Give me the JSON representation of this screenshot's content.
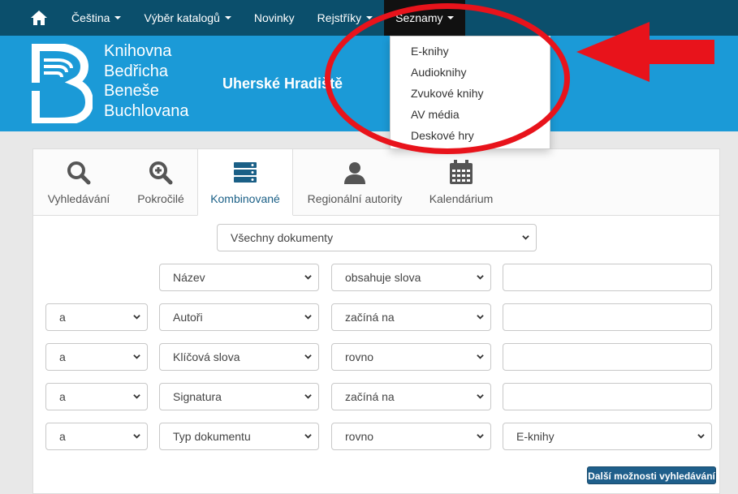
{
  "nav": {
    "items": [
      {
        "label": "Čeština",
        "caret": true
      },
      {
        "label": "Výběr katalogů",
        "caret": true
      },
      {
        "label": "Novinky",
        "caret": false
      },
      {
        "label": "Rejstříky",
        "caret": true
      },
      {
        "label": "Seznamy",
        "caret": true
      }
    ]
  },
  "banner": {
    "logo_lines": [
      "Knihovna",
      "Bedřicha",
      "Beneše",
      "Buchlovana"
    ],
    "city": "Uherské Hradiště"
  },
  "dropdown": {
    "items": [
      "E-knihy",
      "Audioknihy",
      "Zvukové knihy",
      "AV média",
      "Deskové hry"
    ]
  },
  "tabs": [
    {
      "label": "Vyhledávání",
      "icon": "search-icon"
    },
    {
      "label": "Pokročilé",
      "icon": "zoom-in-icon"
    },
    {
      "label": "Kombinované",
      "icon": "server-icon"
    },
    {
      "label": "Regionální autority",
      "icon": "user-icon"
    },
    {
      "label": "Kalendárium",
      "icon": "calendar-icon"
    }
  ],
  "search": {
    "document_type": "Všechny dokumenty",
    "rows": [
      {
        "operator": "",
        "field": "Název",
        "condition": "obsahuje slova",
        "value": ""
      },
      {
        "operator": "a",
        "field": "Autoři",
        "condition": "začíná na",
        "value": ""
      },
      {
        "operator": "a",
        "field": "Klíčová slova",
        "condition": "rovno",
        "value": ""
      },
      {
        "operator": "a",
        "field": "Signatura",
        "condition": "začíná na",
        "value": ""
      },
      {
        "operator": "a",
        "field": "Typ dokumentu",
        "condition": "rovno",
        "value": "E-knihy"
      }
    ],
    "more_button": "Další možnosti vyhledávání"
  },
  "colors": {
    "nav_bg": "#0b4f6c",
    "banner_bg": "#1b9ad7",
    "annotation": "#e8131b",
    "button": "#1f5f8b"
  }
}
